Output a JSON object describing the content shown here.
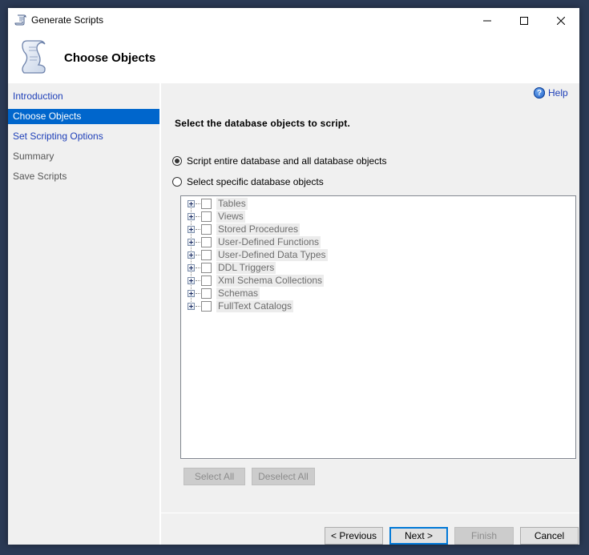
{
  "window": {
    "title": "Generate Scripts",
    "icon": "script-scroll-icon",
    "controls": {
      "minimize": "minimize-icon",
      "maximize": "maximize-icon",
      "close": "close-icon"
    }
  },
  "header": {
    "title": "Choose Objects",
    "icon": "script-scroll-icon"
  },
  "sidebar": {
    "items": [
      {
        "label": "Introduction",
        "state": "link"
      },
      {
        "label": "Choose Objects",
        "state": "active"
      },
      {
        "label": "Set Scripting Options",
        "state": "link"
      },
      {
        "label": "Summary",
        "state": "disabled"
      },
      {
        "label": "Save Scripts",
        "state": "disabled"
      }
    ]
  },
  "content": {
    "help_label": "Help",
    "help_icon_glyph": "?",
    "section_title": "Select the database objects to script.",
    "options": [
      {
        "label": "Script entire database and all database objects",
        "checked": true
      },
      {
        "label": "Select specific database objects",
        "checked": false
      }
    ],
    "tree_items": [
      {
        "label": "Tables",
        "checked": false
      },
      {
        "label": "Views",
        "checked": false
      },
      {
        "label": "Stored Procedures",
        "checked": false
      },
      {
        "label": "User-Defined Functions",
        "checked": false
      },
      {
        "label": "User-Defined Data Types",
        "checked": false
      },
      {
        "label": "DDL Triggers",
        "checked": false
      },
      {
        "label": "Xml Schema Collections",
        "checked": false
      },
      {
        "label": "Schemas",
        "checked": false
      },
      {
        "label": "FullText Catalogs",
        "checked": false
      }
    ],
    "select_all_label": "Select All",
    "deselect_all_label": "Deselect All"
  },
  "footer": {
    "previous_label": "< Previous",
    "next_label": "Next >",
    "finish_label": "Finish",
    "cancel_label": "Cancel"
  },
  "colors": {
    "accent": "#0066cc",
    "link": "#1e3fb8",
    "default_button_border": "#0078d7"
  }
}
